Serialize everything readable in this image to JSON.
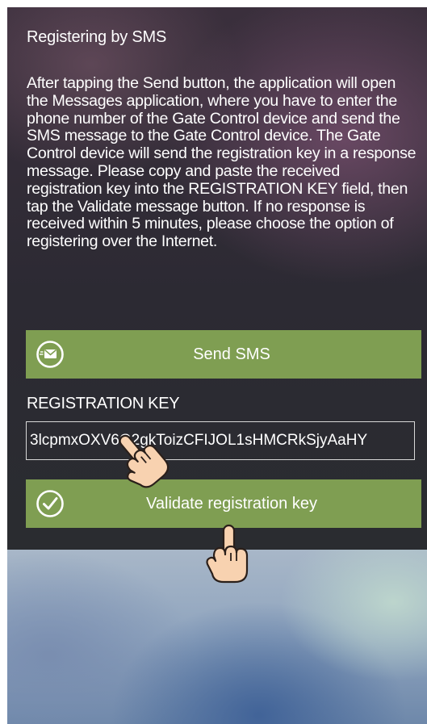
{
  "screen": {
    "heading": "Registering by SMS",
    "instructions": "After tapping the Send button, the application will open the Messages application, where you have to enter the phone number of the Gate Control device and send the SMS message to the Gate Control device. The Gate Control device will send the registration key in a response message. Please copy and paste the received registration key into the REGISTRATION KEY field, then tap the Validate message button. If no response is received within 5 minutes, please choose the option of registering over the Internet."
  },
  "send_button": {
    "label": "Send SMS",
    "icon": "envelope-icon"
  },
  "registration_key": {
    "label": "REGISTRATION KEY",
    "value": "3lcpmxOXV6G2gkToizCFIJOL1sHMCRkSjyAaHY"
  },
  "validate_button": {
    "label": "Validate registration key",
    "icon": "checkmark-icon"
  },
  "colors": {
    "button_green": "#7f9e52",
    "text": "#ffffff"
  }
}
